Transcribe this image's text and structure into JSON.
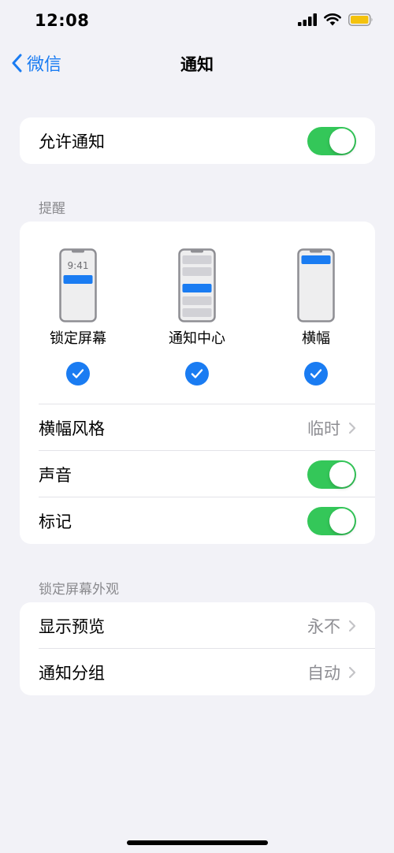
{
  "status_bar": {
    "time": "12:08",
    "battery_color": "#f4c20d"
  },
  "nav": {
    "back_label": "微信",
    "title": "通知"
  },
  "allow_notifications": {
    "label": "允许通知",
    "enabled": true
  },
  "alerts_section": {
    "header": "提醒",
    "options": [
      {
        "label": "锁定屏幕",
        "preview_time": "9:41",
        "checked": true
      },
      {
        "label": "通知中心",
        "checked": true
      },
      {
        "label": "横幅",
        "checked": true
      }
    ],
    "banner_style": {
      "label": "横幅风格",
      "value": "临时"
    },
    "sounds": {
      "label": "声音",
      "enabled": true
    },
    "badges": {
      "label": "标记",
      "enabled": true
    }
  },
  "lock_screen_section": {
    "header": "锁定屏幕外观",
    "show_previews": {
      "label": "显示预览",
      "value": "永不"
    },
    "notification_grouping": {
      "label": "通知分组",
      "value": "自动"
    }
  },
  "colors": {
    "accent": "#1a7cf2",
    "toggle_on": "#34c759",
    "background": "#f2f2f7"
  }
}
